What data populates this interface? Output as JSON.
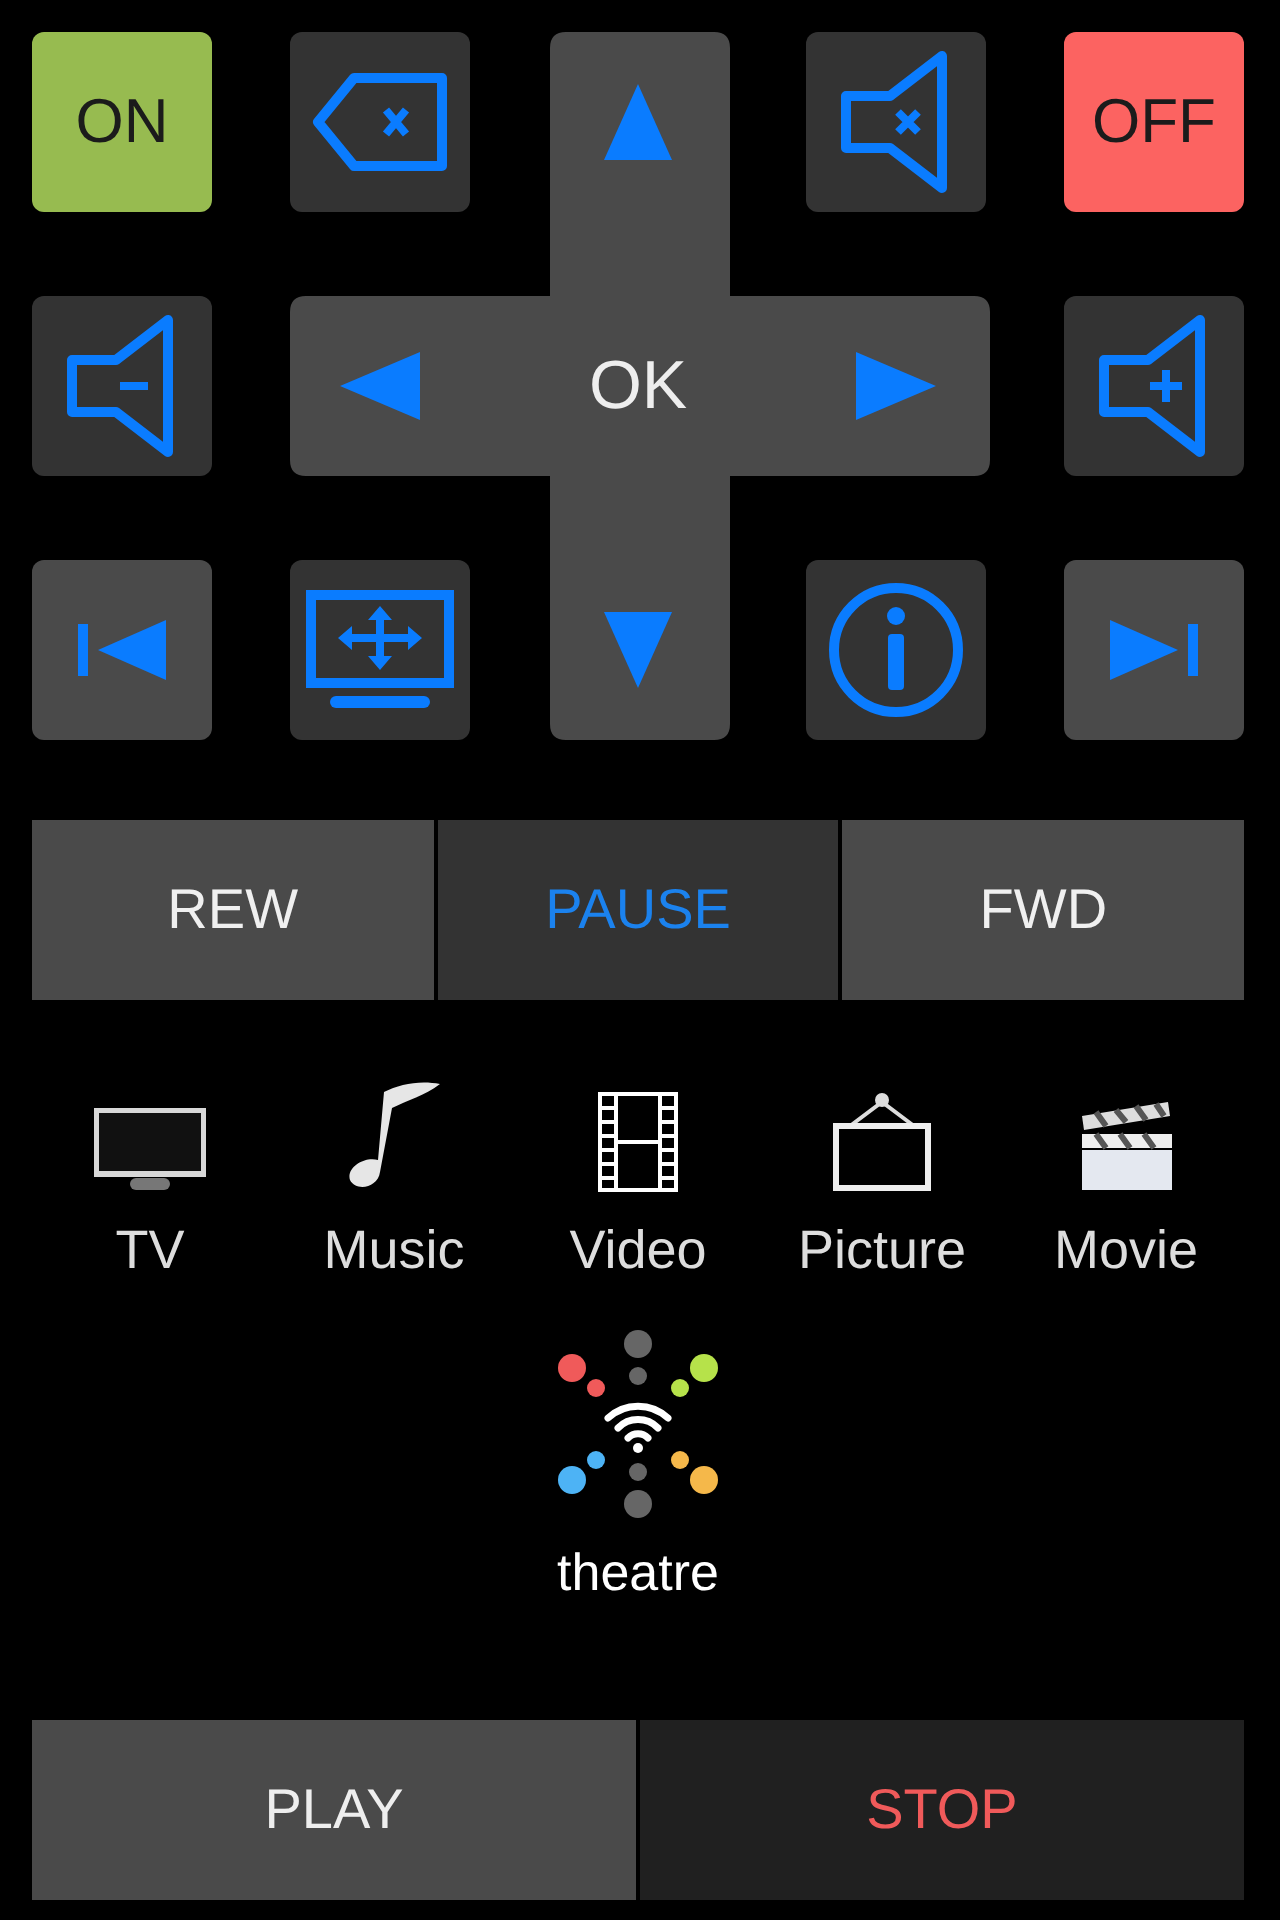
{
  "keys": [
    {
      "kind": "on",
      "label": "ON"
    },
    {
      "kind": "backspace"
    },
    {
      "kind": "up"
    },
    {
      "kind": "mute"
    },
    {
      "kind": "off",
      "label": "OFF"
    },
    {
      "kind": "volume-down"
    },
    {
      "kind": "left"
    },
    {
      "kind": "ok",
      "label": "OK"
    },
    {
      "kind": "right"
    },
    {
      "kind": "volume-up"
    },
    {
      "kind": "previous"
    },
    {
      "kind": "screen"
    },
    {
      "kind": "down"
    },
    {
      "kind": "info"
    },
    {
      "kind": "next"
    }
  ],
  "transport": [
    {
      "label": "REW",
      "selected": false
    },
    {
      "label": "PAUSE",
      "selected": true
    },
    {
      "label": "FWD",
      "selected": false
    }
  ],
  "sources": [
    {
      "kind": "tv",
      "label": "TV"
    },
    {
      "kind": "music",
      "label": "Music"
    },
    {
      "kind": "video",
      "label": "Video"
    },
    {
      "kind": "picture",
      "label": "Picture"
    },
    {
      "kind": "movie",
      "label": "Movie"
    }
  ],
  "theatre": {
    "label": "theatre"
  },
  "playback": [
    {
      "kind": "play",
      "label": "PLAY"
    },
    {
      "kind": "stop",
      "label": "STOP"
    }
  ]
}
